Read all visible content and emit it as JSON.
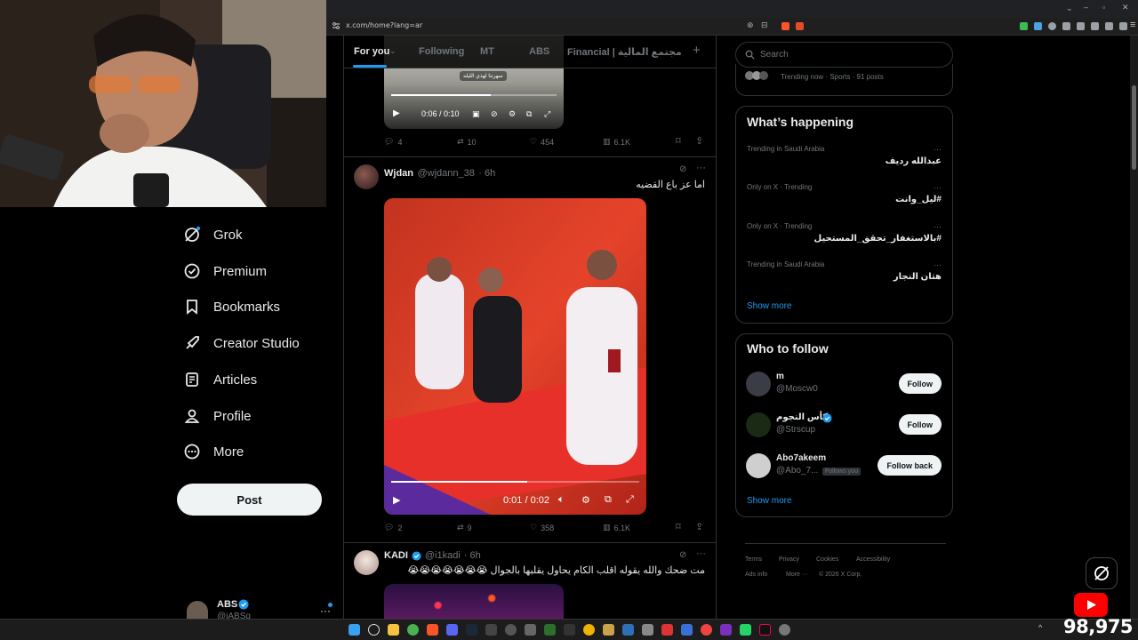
{
  "browser": {
    "url": "x.com/home?lang=ar"
  },
  "nav": {
    "items": [
      {
        "label": "Grok",
        "icon": "grok-icon"
      },
      {
        "label": "Premium",
        "icon": "verified-badge-icon"
      },
      {
        "label": "Bookmarks",
        "icon": "bookmark-icon"
      },
      {
        "label": "Creator Studio",
        "icon": "rocket-icon"
      },
      {
        "label": "Articles",
        "icon": "article-icon"
      },
      {
        "label": "Profile",
        "icon": "person-icon"
      },
      {
        "label": "More",
        "icon": "more-circle-icon"
      }
    ],
    "post_label": "Post",
    "account": {
      "name": "ABS",
      "handle": "@iABSg"
    }
  },
  "tabs": [
    "For you",
    "Following",
    "MT",
    "ABS",
    "Financial | مجتمع المالية"
  ],
  "posts": [
    {
      "video": {
        "time": "0:06 / 0:10",
        "caption": "سهرتنا لهذي الليله",
        "progress": 0.6
      },
      "stats": {
        "replies": "4",
        "reposts": "10",
        "likes": "454",
        "views": "6.1K"
      }
    },
    {
      "name": "Wjdan",
      "handle": "@wjdann_38",
      "time": "· 6h",
      "text": "اما عز باع القضيه",
      "video": {
        "time": "0:01 / 0:02",
        "progress": 0.55
      },
      "stats": {
        "replies": "2",
        "reposts": "9",
        "likes": "358",
        "views": "6.1K"
      }
    },
    {
      "name": "KADI",
      "handle": "@i1kadi",
      "time": "· 6h",
      "text": "مت ضحك والله يقوله اقلب الكام يحاول يقلبها بالجوال 😭😭😭😭😭😭😭"
    }
  ],
  "sidebar": {
    "search_placeholder": "Search",
    "trending_now": "Trending now · Sports · 91 posts",
    "whats_happening_title": "What’s happening",
    "trends": [
      {
        "meta": "Trending in Saudi Arabia",
        "name": "عبدالله رديف"
      },
      {
        "meta": "Only on X · Trending",
        "name": "#ليل_وانت"
      },
      {
        "meta": "Only on X · Trending",
        "name": "#بالاستغفار_تحقق_المستحيل"
      },
      {
        "meta": "Trending in Saudi Arabia",
        "name": "هتان النجار"
      }
    ],
    "show_more": "Show more",
    "who_to_follow_title": "Who to follow",
    "follow": [
      {
        "name": "m",
        "handle": "@Moscw0",
        "button": "Follow"
      },
      {
        "name": "كأس النجوم",
        "handle": "@Strscup",
        "button": "Follow",
        "verified": true
      },
      {
        "name": "Abo7akeem",
        "handle": "@Abo_7...",
        "button": "Follow back",
        "follows_you": "Follows you"
      }
    ],
    "footer": {
      "links": [
        "Terms",
        "Privacy",
        "Cookies",
        "Accessibility",
        "Ads info",
        "More ···"
      ],
      "copyright": "© 2026 X Corp."
    }
  },
  "stream": {
    "viewers": "98,975"
  },
  "colors": {
    "accent": "#1d9bf0",
    "bg": "#000000",
    "border": "#2f3336",
    "muted": "#71767b"
  }
}
